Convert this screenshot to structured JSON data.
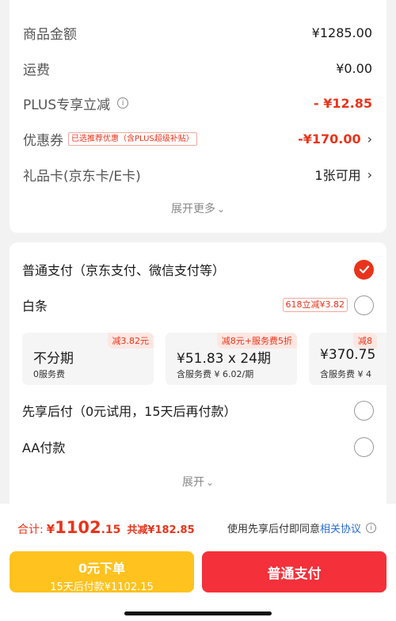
{
  "summary": {
    "goods_label": "商品金额",
    "goods_value": "¥1285.00",
    "shipping_label": "运费",
    "shipping_value": "¥0.00",
    "plus_label": "PLUS专享立减",
    "plus_value": "- ¥12.85",
    "coupon_label": "优惠券",
    "coupon_tag": "已选推荐优惠（含PLUS超级补贴）",
    "coupon_value": "-¥170.00",
    "giftcard_label": "礼品卡(京东卡/E卡)",
    "giftcard_value": "1张可用",
    "expand_more": "展开更多"
  },
  "payment": {
    "normal_label": "普通支付（京东支付、微信支付等）",
    "baitiao_label": "白条",
    "baitiao_tag": "618立减¥3.82",
    "installments": [
      {
        "badge": "减3.82元",
        "main": "不分期",
        "sub": "0服务费"
      },
      {
        "badge": "减8元+服务费5折",
        "main": "¥51.83 x 24期",
        "sub": "含服务费 ¥ 6.02/期"
      },
      {
        "badge": "减8",
        "main": "¥370.75",
        "sub": "含服务费 ¥ 4"
      }
    ],
    "later_label": "先享后付（0元试用，15天后再付款）",
    "aa_label": "AA付款",
    "expand": "展开"
  },
  "footer": {
    "total_label": "合计:",
    "total_yen": "¥",
    "total_int": "1102",
    "total_dec": ".15",
    "saved": "共减¥182.85",
    "agree_text": "使用先享后付即同意",
    "agree_link": "相关协议",
    "btn_left_line1": "0元下单",
    "btn_left_line2": "15天后付款¥1102.15",
    "btn_right": "普通支付"
  },
  "colors": {
    "accent_red": "#e8341c",
    "button_red": "#f4303a",
    "button_yellow": "#ffc21f",
    "link_blue": "#2b6cd8"
  },
  "icons": [
    "info-icon",
    "chevron-right-icon",
    "chevron-down-icon",
    "check-icon"
  ]
}
